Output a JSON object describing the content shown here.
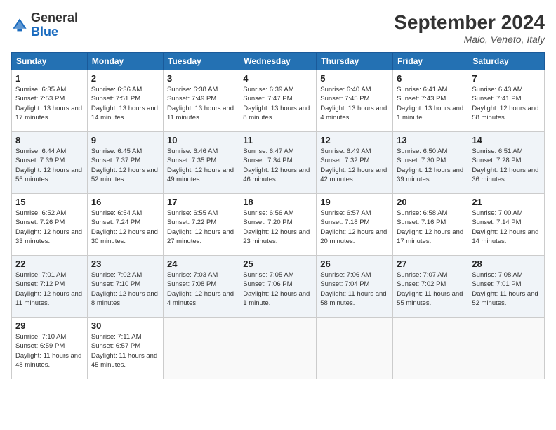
{
  "logo": {
    "general": "General",
    "blue": "Blue"
  },
  "title": "September 2024",
  "location": "Malo, Veneto, Italy",
  "days_of_week": [
    "Sunday",
    "Monday",
    "Tuesday",
    "Wednesday",
    "Thursday",
    "Friday",
    "Saturday"
  ],
  "weeks": [
    [
      {
        "day": "1",
        "sunrise": "6:35 AM",
        "sunset": "7:53 PM",
        "daylight": "13 hours and 17 minutes."
      },
      {
        "day": "2",
        "sunrise": "6:36 AM",
        "sunset": "7:51 PM",
        "daylight": "13 hours and 14 minutes."
      },
      {
        "day": "3",
        "sunrise": "6:38 AM",
        "sunset": "7:49 PM",
        "daylight": "13 hours and 11 minutes."
      },
      {
        "day": "4",
        "sunrise": "6:39 AM",
        "sunset": "7:47 PM",
        "daylight": "13 hours and 8 minutes."
      },
      {
        "day": "5",
        "sunrise": "6:40 AM",
        "sunset": "7:45 PM",
        "daylight": "13 hours and 4 minutes."
      },
      {
        "day": "6",
        "sunrise": "6:41 AM",
        "sunset": "7:43 PM",
        "daylight": "13 hours and 1 minute."
      },
      {
        "day": "7",
        "sunrise": "6:43 AM",
        "sunset": "7:41 PM",
        "daylight": "12 hours and 58 minutes."
      }
    ],
    [
      {
        "day": "8",
        "sunrise": "6:44 AM",
        "sunset": "7:39 PM",
        "daylight": "12 hours and 55 minutes."
      },
      {
        "day": "9",
        "sunrise": "6:45 AM",
        "sunset": "7:37 PM",
        "daylight": "12 hours and 52 minutes."
      },
      {
        "day": "10",
        "sunrise": "6:46 AM",
        "sunset": "7:35 PM",
        "daylight": "12 hours and 49 minutes."
      },
      {
        "day": "11",
        "sunrise": "6:47 AM",
        "sunset": "7:34 PM",
        "daylight": "12 hours and 46 minutes."
      },
      {
        "day": "12",
        "sunrise": "6:49 AM",
        "sunset": "7:32 PM",
        "daylight": "12 hours and 42 minutes."
      },
      {
        "day": "13",
        "sunrise": "6:50 AM",
        "sunset": "7:30 PM",
        "daylight": "12 hours and 39 minutes."
      },
      {
        "day": "14",
        "sunrise": "6:51 AM",
        "sunset": "7:28 PM",
        "daylight": "12 hours and 36 minutes."
      }
    ],
    [
      {
        "day": "15",
        "sunrise": "6:52 AM",
        "sunset": "7:26 PM",
        "daylight": "12 hours and 33 minutes."
      },
      {
        "day": "16",
        "sunrise": "6:54 AM",
        "sunset": "7:24 PM",
        "daylight": "12 hours and 30 minutes."
      },
      {
        "day": "17",
        "sunrise": "6:55 AM",
        "sunset": "7:22 PM",
        "daylight": "12 hours and 27 minutes."
      },
      {
        "day": "18",
        "sunrise": "6:56 AM",
        "sunset": "7:20 PM",
        "daylight": "12 hours and 23 minutes."
      },
      {
        "day": "19",
        "sunrise": "6:57 AM",
        "sunset": "7:18 PM",
        "daylight": "12 hours and 20 minutes."
      },
      {
        "day": "20",
        "sunrise": "6:58 AM",
        "sunset": "7:16 PM",
        "daylight": "12 hours and 17 minutes."
      },
      {
        "day": "21",
        "sunrise": "7:00 AM",
        "sunset": "7:14 PM",
        "daylight": "12 hours and 14 minutes."
      }
    ],
    [
      {
        "day": "22",
        "sunrise": "7:01 AM",
        "sunset": "7:12 PM",
        "daylight": "12 hours and 11 minutes."
      },
      {
        "day": "23",
        "sunrise": "7:02 AM",
        "sunset": "7:10 PM",
        "daylight": "12 hours and 8 minutes."
      },
      {
        "day": "24",
        "sunrise": "7:03 AM",
        "sunset": "7:08 PM",
        "daylight": "12 hours and 4 minutes."
      },
      {
        "day": "25",
        "sunrise": "7:05 AM",
        "sunset": "7:06 PM",
        "daylight": "12 hours and 1 minute."
      },
      {
        "day": "26",
        "sunrise": "7:06 AM",
        "sunset": "7:04 PM",
        "daylight": "11 hours and 58 minutes."
      },
      {
        "day": "27",
        "sunrise": "7:07 AM",
        "sunset": "7:02 PM",
        "daylight": "11 hours and 55 minutes."
      },
      {
        "day": "28",
        "sunrise": "7:08 AM",
        "sunset": "7:01 PM",
        "daylight": "11 hours and 52 minutes."
      }
    ],
    [
      {
        "day": "29",
        "sunrise": "7:10 AM",
        "sunset": "6:59 PM",
        "daylight": "11 hours and 48 minutes."
      },
      {
        "day": "30",
        "sunrise": "7:11 AM",
        "sunset": "6:57 PM",
        "daylight": "11 hours and 45 minutes."
      },
      null,
      null,
      null,
      null,
      null
    ]
  ]
}
